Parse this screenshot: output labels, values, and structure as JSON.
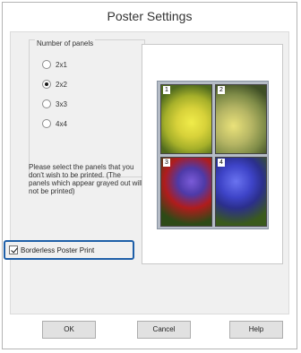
{
  "window": {
    "title": "Poster Settings"
  },
  "panels_group": {
    "label": "Number of panels",
    "options": [
      {
        "label": "2x1",
        "checked": false
      },
      {
        "label": "2x2",
        "checked": true
      },
      {
        "label": "3x3",
        "checked": false
      },
      {
        "label": "4x4",
        "checked": false
      }
    ]
  },
  "instructions": "Please select the panels that you don't wish to be printed. (The panels which appear grayed out will not be printed)",
  "borderless": {
    "label": "Borderless Poster Print",
    "checked": true
  },
  "preview": {
    "panels": [
      "1",
      "2",
      "3",
      "4"
    ]
  },
  "buttons": {
    "ok": "OK",
    "cancel": "Cancel",
    "help": "Help"
  },
  "colors": {
    "highlight": "#1e5fa8",
    "panel_bg": "#f0f0f0"
  }
}
